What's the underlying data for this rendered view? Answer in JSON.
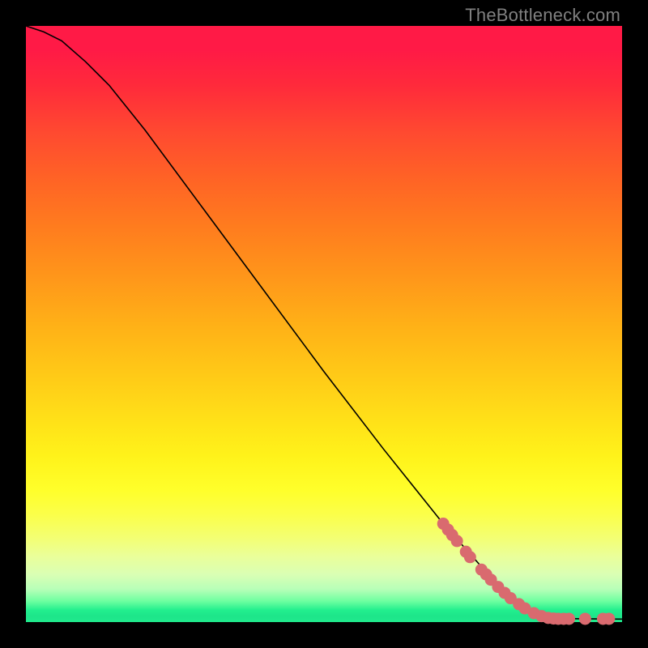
{
  "watermark": "TheBottleneck.com",
  "colors": {
    "background": "#000000",
    "curve_stroke": "#000000",
    "marker_fill": "#d96a6f",
    "marker_stroke": "#d96a6f"
  },
  "chart_data": {
    "type": "line",
    "title": "",
    "xlabel": "",
    "ylabel": "",
    "xlim": [
      0,
      100
    ],
    "ylim": [
      0,
      100
    ],
    "grid": false,
    "legend": false,
    "curve": [
      {
        "x": 0,
        "y": 100
      },
      {
        "x": 3,
        "y": 99
      },
      {
        "x": 6,
        "y": 97.5
      },
      {
        "x": 10,
        "y": 94
      },
      {
        "x": 14,
        "y": 90
      },
      {
        "x": 20,
        "y": 82.5
      },
      {
        "x": 30,
        "y": 69
      },
      {
        "x": 40,
        "y": 55.5
      },
      {
        "x": 50,
        "y": 42
      },
      {
        "x": 60,
        "y": 29
      },
      {
        "x": 70,
        "y": 16.5
      },
      {
        "x": 78,
        "y": 7.5
      },
      {
        "x": 83,
        "y": 3.0
      },
      {
        "x": 86,
        "y": 1.2
      },
      {
        "x": 88,
        "y": 0.6
      },
      {
        "x": 100,
        "y": 0.5
      }
    ],
    "markers": [
      {
        "x": 70.0,
        "y": 16.5
      },
      {
        "x": 70.8,
        "y": 15.5
      },
      {
        "x": 71.5,
        "y": 14.6
      },
      {
        "x": 72.3,
        "y": 13.6
      },
      {
        "x": 73.8,
        "y": 11.8
      },
      {
        "x": 74.5,
        "y": 10.9
      },
      {
        "x": 76.4,
        "y": 8.8
      },
      {
        "x": 77.2,
        "y": 8.0
      },
      {
        "x": 78.0,
        "y": 7.1
      },
      {
        "x": 79.2,
        "y": 5.9
      },
      {
        "x": 80.3,
        "y": 4.9
      },
      {
        "x": 81.3,
        "y": 4.0
      },
      {
        "x": 82.7,
        "y": 3.0
      },
      {
        "x": 83.7,
        "y": 2.3
      },
      {
        "x": 85.2,
        "y": 1.5
      },
      {
        "x": 86.5,
        "y": 1.0
      },
      {
        "x": 87.6,
        "y": 0.7
      },
      {
        "x": 88.5,
        "y": 0.6
      },
      {
        "x": 89.3,
        "y": 0.55
      },
      {
        "x": 90.2,
        "y": 0.55
      },
      {
        "x": 91.1,
        "y": 0.55
      },
      {
        "x": 93.8,
        "y": 0.55
      },
      {
        "x": 96.8,
        "y": 0.55
      },
      {
        "x": 97.8,
        "y": 0.55
      }
    ]
  }
}
